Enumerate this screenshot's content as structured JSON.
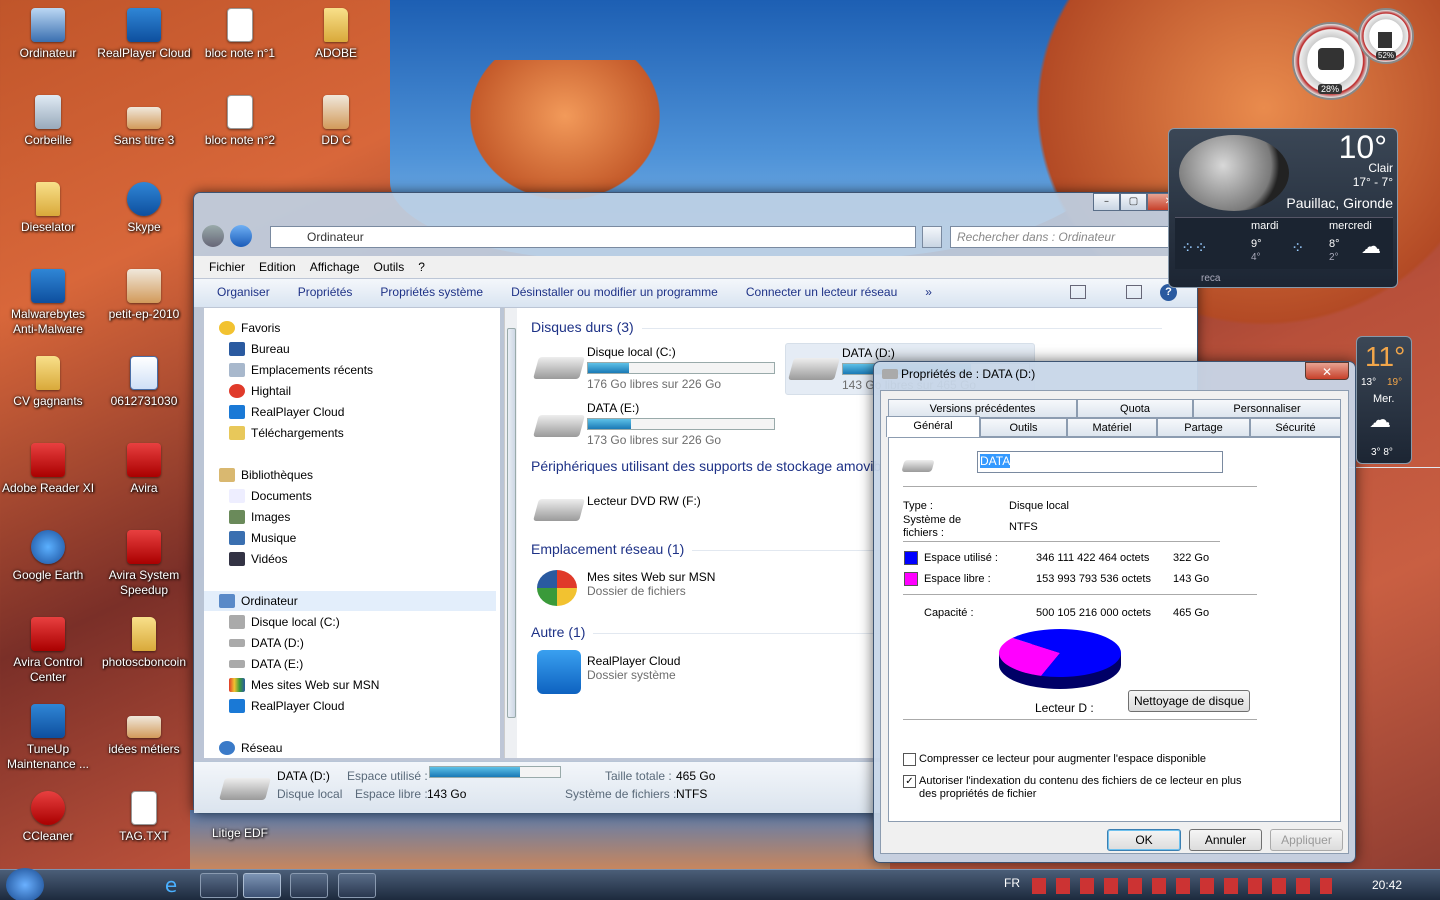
{
  "desktop_icons": [
    {
      "label": "Ordinateur",
      "x": 0,
      "y": 0
    },
    {
      "label": "RealPlayer Cloud"
    },
    {
      "label": "bloc note n°1"
    },
    {
      "label": "ADOBE"
    },
    {
      "label": "Corbeille"
    },
    {
      "label": "Sans titre 3"
    },
    {
      "label": "bloc note n°2"
    },
    {
      "label": "DD C"
    },
    {
      "label": "Dieselator"
    },
    {
      "label": "Skype"
    },
    {
      "label": "Malwarebytes Anti-Malware"
    },
    {
      "label": "petit-ep-2010"
    },
    {
      "label": "CV gagnants"
    },
    {
      "label": "0612731030"
    },
    {
      "label": "Adobe Reader XI"
    },
    {
      "label": "Avira"
    },
    {
      "label": "Google Earth"
    },
    {
      "label": "Avira System Speedup"
    },
    {
      "label": "Avira Control Center"
    },
    {
      "label": "photoscboncoin"
    },
    {
      "label": "TuneUp Maintenance ..."
    },
    {
      "label": "idées métiers"
    },
    {
      "label": "CCleaner"
    },
    {
      "label": "TAG.TXT"
    },
    {
      "label": "Litige EDF"
    }
  ],
  "explorer": {
    "address": "Ordinateur",
    "search_placeholder": "Rechercher dans : Ordinateur",
    "menu": [
      "Fichier",
      "Edition",
      "Affichage",
      "Outils",
      "?"
    ],
    "commands": [
      "Organiser",
      "Propriétés",
      "Propriétés système",
      "Désinstaller ou modifier un programme",
      "Connecter un lecteur réseau",
      "»"
    ],
    "tree": {
      "favoris": "Favoris",
      "bureau": "Bureau",
      "recents": "Emplacements récents",
      "hightail": "Hightail",
      "realplayer": "RealPlayer Cloud",
      "telechargements": "Téléchargements",
      "bibliotheques": "Bibliothèques",
      "documents": "Documents",
      "images": "Images",
      "musique": "Musique",
      "videos": "Vidéos",
      "ordinateur": "Ordinateur",
      "disque_c": "Disque local (C:)",
      "data_d": "DATA (D:)",
      "data_e": "DATA (E:)",
      "msn": "Mes sites Web sur MSN",
      "realplayer2": "RealPlayer Cloud",
      "reseau": "Réseau"
    },
    "sections": {
      "disques": "Disques durs (3)",
      "peripheriques": "Périphériques utilisant des supports de stockage amovibles (1)",
      "reseau": "Emplacement réseau (1)",
      "autre": "Autre (1)"
    },
    "drives": [
      {
        "name": "Disque local (C:)",
        "free": "176 Go libres sur 226 Go",
        "used_fraction": 0.22
      },
      {
        "name": "DATA (D:)",
        "free": "143 Go libres sur 465 Go",
        "used_fraction": 0.69
      },
      {
        "name": "DATA (E:)",
        "free": "173 Go libres sur 226 Go",
        "used_fraction": 0.23
      }
    ],
    "dvd": "Lecteur DVD RW (F:)",
    "msn": {
      "name": "Mes sites Web sur MSN",
      "type": "Dossier de fichiers"
    },
    "realplayer": {
      "name": "RealPlayer Cloud",
      "type": "Dossier système"
    },
    "details": {
      "name": "DATA (D:)",
      "type": "Disque local",
      "used_label": "Espace utilisé :",
      "free_label": "Espace libre :",
      "free": "143 Go",
      "total_label": "Taille totale :",
      "total": "465 Go",
      "fs_label": "Système de fichiers :",
      "fs": "NTFS",
      "used_fraction": 0.69
    }
  },
  "dialog": {
    "title": "Propriétés de : DATA (D:)",
    "tabs_row1": [
      "Versions précédentes",
      "Quota",
      "Personnaliser"
    ],
    "tabs_row2": [
      "Général",
      "Outils",
      "Matériel",
      "Partage",
      "Sécurité"
    ],
    "name_value": "DATA",
    "type_label": "Type :",
    "type_value": "Disque local",
    "fs_label": "Système de fichiers :",
    "fs_value": "NTFS",
    "used_label": "Espace utilisé :",
    "used_bytes": "346 111 422 464 octets",
    "used_go": "322 Go",
    "free_label": "Espace libre :",
    "free_bytes": "153 993 793 536 octets",
    "free_go": "143 Go",
    "cap_label": "Capacité :",
    "cap_bytes": "500 105 216 000 octets",
    "cap_go": "465 Go",
    "drive_label": "Lecteur D :",
    "cleanup": "Nettoyage de disque",
    "compress": "Compresser ce lecteur pour augmenter l'espace disponible",
    "index": "Autoriser l'indexation du contenu des fichiers de ce lecteur en plus des propriétés de fichier",
    "ok": "OK",
    "cancel": "Annuler",
    "apply": "Appliquer",
    "used_color": "#0000ff",
    "free_color": "#ff00ff",
    "used_fraction": 0.692
  },
  "gadgets": {
    "cpu": "28%",
    "ram": "52%",
    "weather": {
      "temp": "10°",
      "cond": "Clair",
      "hilo": "17° - 7°",
      "city": "Pauillac, Gironde",
      "d1": "mardi",
      "d1_hi": "9°",
      "d1_lo": "4°",
      "d2": "mercredi",
      "d2_hi": "8°",
      "d2_lo": "2°",
      "footer": "reca"
    },
    "weather2": {
      "temp": "11°",
      "lo": "13°",
      "hi": "19°",
      "day": "Mer.",
      "range": "3° 8°"
    }
  },
  "taskbar": {
    "lang": "FR",
    "time": "20:42"
  }
}
